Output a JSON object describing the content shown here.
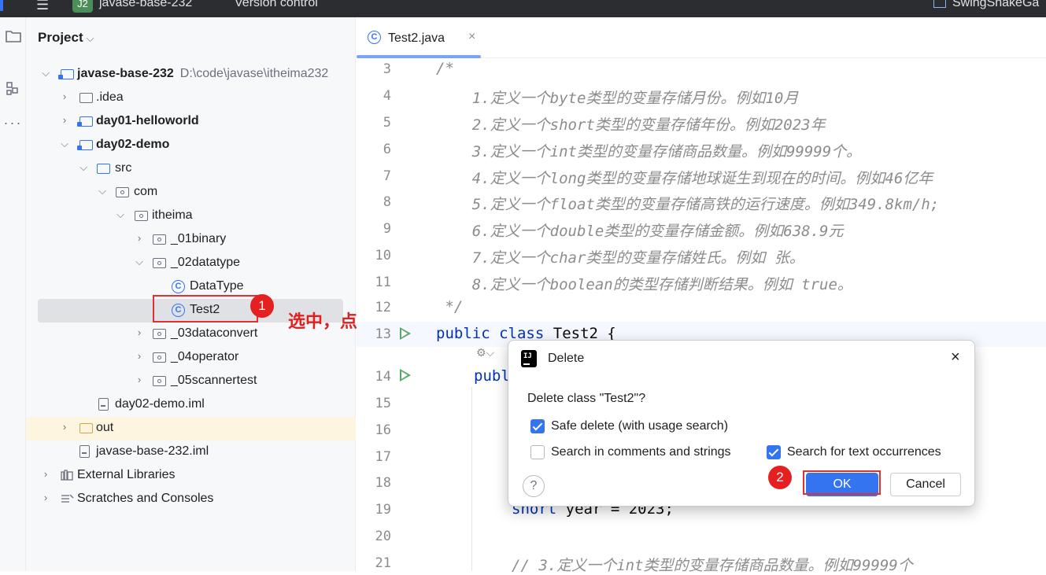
{
  "topbar": {
    "project_badge": "J2",
    "project_name": "javase-base-232",
    "vcs_label": "Version control",
    "right_label": "SwingSnakeGa"
  },
  "project_panel": {
    "title": "Project",
    "tree": [
      {
        "label": "javase-base-232",
        "path": "D:\\code\\javase\\itheima232"
      },
      {
        "label": ".idea"
      },
      {
        "label": "day01-helloworld"
      },
      {
        "label": "day02-demo"
      },
      {
        "label": "src"
      },
      {
        "label": "com"
      },
      {
        "label": "itheima"
      },
      {
        "label": "_01binary"
      },
      {
        "label": "_02datatype"
      },
      {
        "label": "DataType"
      },
      {
        "label": "Test2"
      },
      {
        "label": "_03dataconvert"
      },
      {
        "label": "_04operator"
      },
      {
        "label": "_05scannertest"
      },
      {
        "label": "day02-demo.iml"
      },
      {
        "label": "out"
      },
      {
        "label": "javase-base-232.iml"
      },
      {
        "label": "External Libraries"
      },
      {
        "label": "Scratches and Consoles"
      }
    ]
  },
  "annotations": {
    "step1_num": "1",
    "step1_text": "选中，点击Delete",
    "step2_num": "2"
  },
  "editor": {
    "tab_label": "Test2.java",
    "tab_close": "×",
    "lines": [
      {
        "num": "3",
        "text": "/*"
      },
      {
        "num": "4",
        "text": "    1.定义一个byte类型的变量存储月份。例如10月"
      },
      {
        "num": "5",
        "text": "    2.定义一个short类型的变量存储年份。例如2023年"
      },
      {
        "num": "6",
        "text": "    3.定义一个int类型的变量存储商品数量。例如99999个。"
      },
      {
        "num": "7",
        "text": "    4.定义一个long类型的变量存储地球诞生到现在的时间。例如46亿年"
      },
      {
        "num": "8",
        "text": "    5.定义一个float类型的变量存储高铁的运行速度。例如349.8km/h;"
      },
      {
        "num": "9",
        "text": "    6.定义一个double类型的变量存储金额。例如638.9元"
      },
      {
        "num": "10",
        "text": "    7.定义一个char类型的变量存储姓氏。例如 张。"
      },
      {
        "num": "11",
        "text": "    8.定义一个boolean的类型存储判断结果。例如 true。"
      },
      {
        "num": "12",
        "text": " */"
      },
      {
        "num": "13",
        "kw1": "public",
        "kw2": "class",
        "rest": "Test2 {"
      },
      {
        "num": "14",
        "text": "publ"
      },
      {
        "num": "15",
        "text": ""
      },
      {
        "num": "16",
        "text": ""
      },
      {
        "num": "17",
        "text": ""
      },
      {
        "num": "18",
        "text": ""
      },
      {
        "num": "19",
        "kw1": "short",
        "rest": "year = 2023;"
      },
      {
        "num": "20",
        "text": ""
      },
      {
        "num": "21",
        "text": "// 3.定义一个int类型的变量存储商品数量。例如99999个"
      }
    ]
  },
  "dialog": {
    "title": "Delete",
    "close": "×",
    "message": "Delete class \"Test2\"?",
    "options": [
      {
        "label": "Safe delete (with usage search)",
        "checked": true
      },
      {
        "label": "Search in comments and strings",
        "checked": false
      },
      {
        "label": "Search for text occurrences",
        "checked": true
      }
    ],
    "help": "?",
    "ok_label": "OK",
    "cancel_label": "Cancel"
  }
}
